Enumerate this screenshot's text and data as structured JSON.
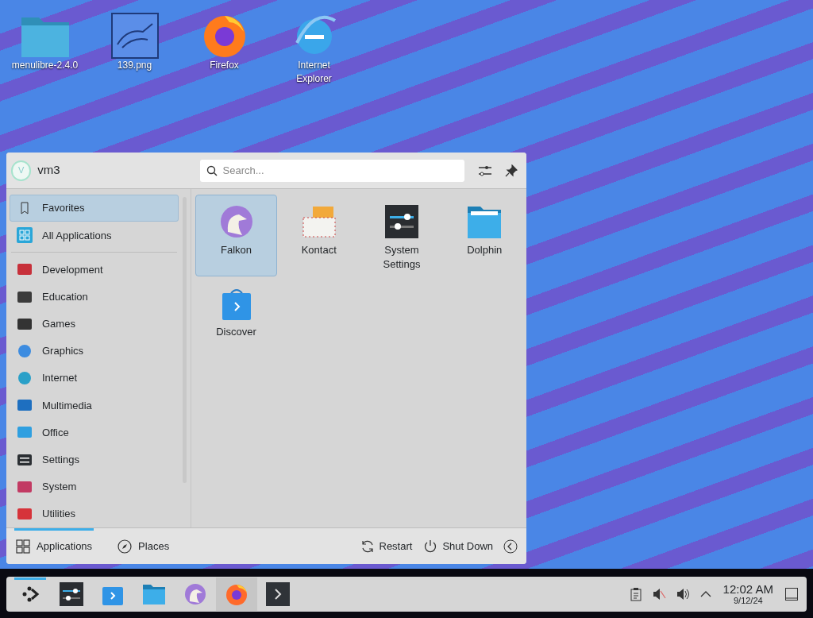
{
  "desktop_icons": [
    {
      "label": "menulibre-2.4.0"
    },
    {
      "label": "139.png"
    },
    {
      "label": "Firefox"
    },
    {
      "label": "Internet Explorer"
    }
  ],
  "menu": {
    "user": {
      "initial": "V",
      "name": "vm3"
    },
    "search": {
      "placeholder": "Search..."
    },
    "sidebar": {
      "top": [
        {
          "label": "Favorites",
          "selected": true
        },
        {
          "label": "All Applications",
          "selected": false
        }
      ],
      "categories": [
        {
          "label": "Development",
          "selected": false
        },
        {
          "label": "Education",
          "selected": false
        },
        {
          "label": "Games",
          "selected": false
        },
        {
          "label": "Graphics",
          "selected": false
        },
        {
          "label": "Internet",
          "selected": false
        },
        {
          "label": "Multimedia",
          "selected": false
        },
        {
          "label": "Office",
          "selected": false
        },
        {
          "label": "Settings",
          "selected": false
        },
        {
          "label": "System",
          "selected": false
        },
        {
          "label": "Utilities",
          "selected": false
        }
      ]
    },
    "apps": [
      {
        "label": "Falkon",
        "selected": true
      },
      {
        "label": "Kontact",
        "selected": false
      },
      {
        "label": "System Settings",
        "selected": false
      },
      {
        "label": "Dolphin",
        "selected": false
      },
      {
        "label": "Discover",
        "selected": false
      }
    ],
    "footer_tabs": [
      {
        "label": "Applications",
        "selected": true
      },
      {
        "label": "Places",
        "selected": false
      }
    ],
    "actions": [
      {
        "label": "Restart"
      },
      {
        "label": "Shut Down"
      }
    ]
  },
  "taskbar": {
    "tasks": [
      {
        "active": true
      },
      {
        "active": false
      },
      {
        "active": false
      },
      {
        "active": false
      },
      {
        "active": false
      },
      {
        "active": true
      },
      {
        "active": false
      }
    ],
    "time": "12:02 AM",
    "date": "9/12/24"
  }
}
